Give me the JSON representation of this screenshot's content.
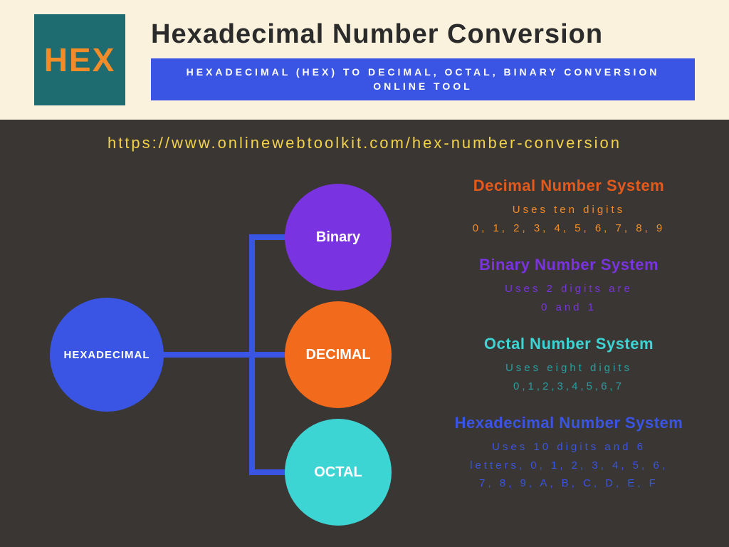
{
  "header": {
    "logo_text": "HEX",
    "title": "Hexadecimal Number Conversion",
    "subtitle": "HEXADECIMAL (HEX) TO DECIMAL, OCTAL, BINARY CONVERSION ONLINE TOOL"
  },
  "url": "https://www.onlinewebtoolkit.com/hex-number-conversion",
  "diagram": {
    "root": "HEXADECIMAL",
    "nodes": {
      "binary": "Binary",
      "decimal": "DECIMAL",
      "octal": "OCTAL"
    }
  },
  "systems": {
    "decimal": {
      "title": "Decimal Number System",
      "line1": "Uses ten digits",
      "line2": "0, 1, 2, 3, 4, 5, 6, 7, 8, 9"
    },
    "binary": {
      "title": "Binary Number System",
      "line1": "Uses 2 digits are",
      "line2": "0 and 1"
    },
    "octal": {
      "title": "Octal Number System",
      "line1": "Uses eight digits",
      "line2": "0,1,2,3,4,5,6,7"
    },
    "hex": {
      "title": "Hexadecimal Number System",
      "line1": "Uses 10 digits and 6",
      "line2": "letters, 0, 1, 2, 3, 4, 5, 6,",
      "line3": "7, 8, 9, A, B, C, D, E, F"
    }
  }
}
